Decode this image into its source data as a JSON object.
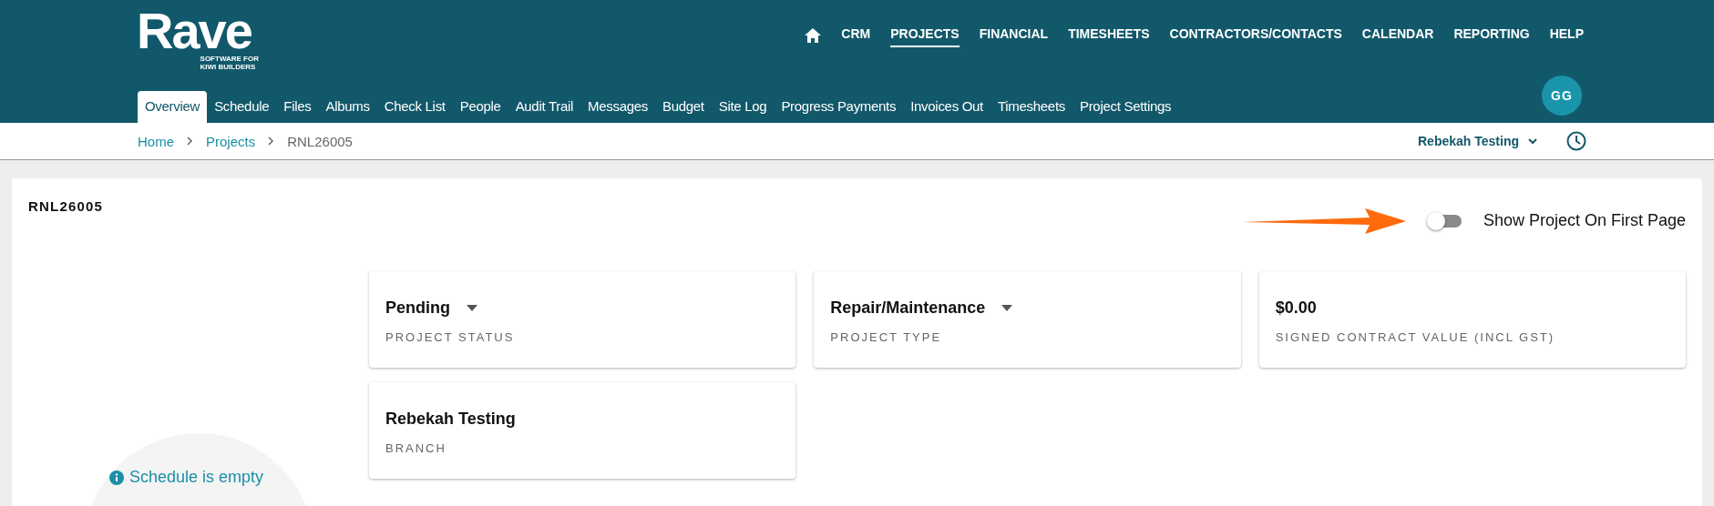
{
  "logo": {
    "name": "Rave",
    "tagline": "SOFTWARE FOR\nKIWI BUILDERS"
  },
  "top_nav": [
    {
      "label": "CRM",
      "selected": false
    },
    {
      "label": "PROJECTS",
      "selected": true
    },
    {
      "label": "FINANCIAL",
      "selected": false
    },
    {
      "label": "TIMESHEETS",
      "selected": false
    },
    {
      "label": "CONTRACTORS/CONTACTS",
      "selected": false
    },
    {
      "label": "CALENDAR",
      "selected": false
    },
    {
      "label": "REPORTING",
      "selected": false
    },
    {
      "label": "HELP",
      "selected": false
    }
  ],
  "tabs": [
    {
      "label": "Overview",
      "selected": true
    },
    {
      "label": "Schedule",
      "selected": false
    },
    {
      "label": "Files",
      "selected": false
    },
    {
      "label": "Albums",
      "selected": false
    },
    {
      "label": "Check List",
      "selected": false
    },
    {
      "label": "People",
      "selected": false
    },
    {
      "label": "Audit Trail",
      "selected": false
    },
    {
      "label": "Messages",
      "selected": false
    },
    {
      "label": "Budget",
      "selected": false
    },
    {
      "label": "Site Log",
      "selected": false
    },
    {
      "label": "Progress Payments",
      "selected": false
    },
    {
      "label": "Invoices Out",
      "selected": false
    },
    {
      "label": "Timesheets",
      "selected": false
    },
    {
      "label": "Project Settings",
      "selected": false
    }
  ],
  "avatar": {
    "initials": "GG"
  },
  "breadcrumb": [
    "Home",
    "Projects",
    "RNL26005"
  ],
  "branch_selector": {
    "label": "Rebekah Testing"
  },
  "project": {
    "code": "RNL26005",
    "toggle": {
      "label": "Show Project On First Page",
      "on": false
    }
  },
  "schedule": {
    "message": "Schedule is empty"
  },
  "cards": [
    {
      "kind": "dropdown",
      "value": "Pending",
      "label": "PROJECT STATUS"
    },
    {
      "kind": "dropdown",
      "value": "Repair/Maintenance",
      "label": "PROJECT TYPE"
    },
    {
      "kind": "plain",
      "value": "$0.00",
      "label": "SIGNED CONTRACT VALUE (INCL GST)"
    },
    {
      "kind": "plain",
      "value": "Rebekah Testing",
      "label": "BRANCH"
    }
  ]
}
